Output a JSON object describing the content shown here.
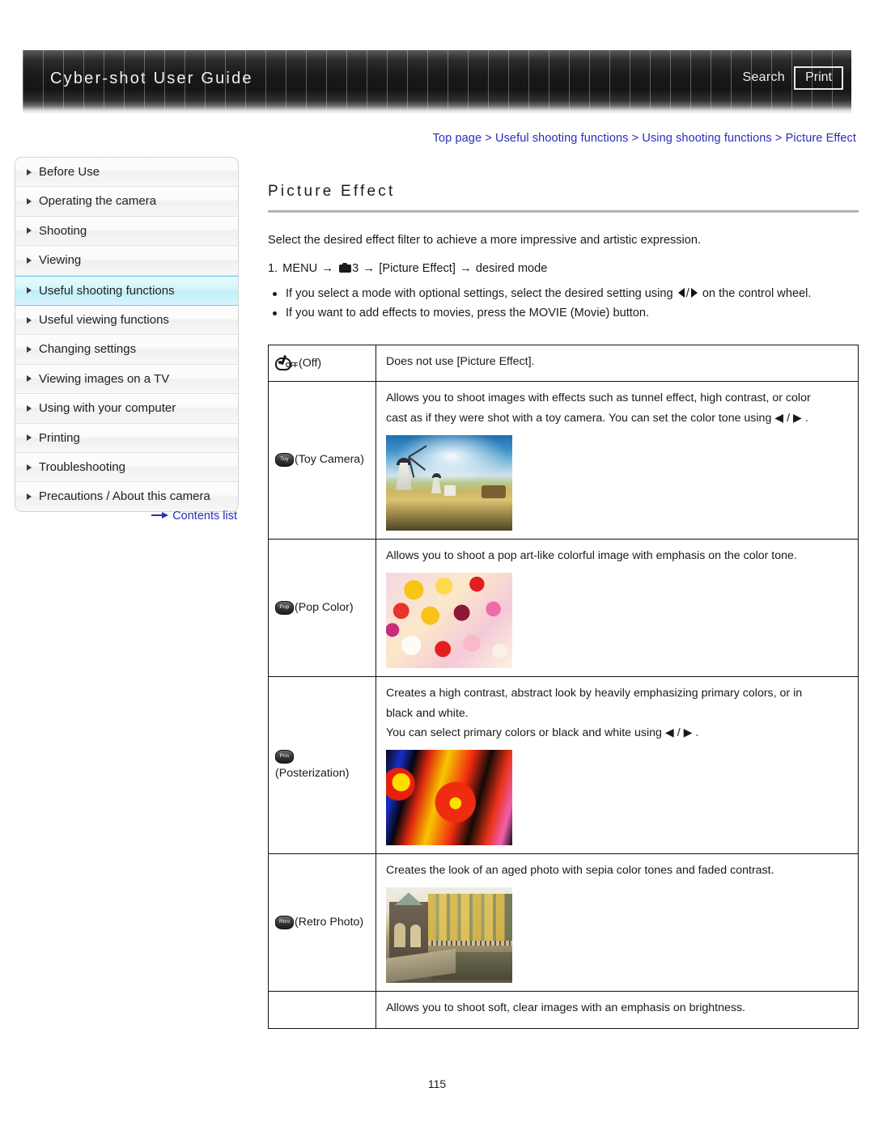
{
  "header": {
    "title": "Cyber-shot User Guide",
    "search_label": "Search",
    "print_label": "Print"
  },
  "breadcrumb": {
    "items": [
      "Top page",
      "Useful shooting functions",
      "Using shooting functions",
      "Picture Effect"
    ],
    "separator": ">",
    "full_text": "Top page > Useful shooting functions > Using shooting functions > Picture Effect"
  },
  "sidebar": {
    "items": [
      {
        "label": "Before Use",
        "active": false
      },
      {
        "label": "Operating the camera",
        "active": false
      },
      {
        "label": "Shooting",
        "active": false
      },
      {
        "label": "Viewing",
        "active": false
      },
      {
        "label": "Useful shooting functions",
        "active": true
      },
      {
        "label": "Useful viewing functions",
        "active": false
      },
      {
        "label": "Changing settings",
        "active": false
      },
      {
        "label": "Viewing images on a TV",
        "active": false
      },
      {
        "label": "Using with your computer",
        "active": false
      },
      {
        "label": "Printing",
        "active": false
      },
      {
        "label": "Troubleshooting",
        "active": false
      },
      {
        "label": "Precautions / About this camera",
        "active": false
      }
    ],
    "contents_link": "Contents list",
    "active_color": "#bfeefa",
    "link_color": "#2b2bbd"
  },
  "main": {
    "title": "Picture Effect",
    "intro": "Select the desired effect filter to achieve a more impressive and artistic expression.",
    "step": {
      "number": "1.",
      "menu": "MENU",
      "tab": "3",
      "item": "[Picture Effect]",
      "result": "desired mode"
    },
    "bullets": [
      "If you select a mode with optional settings, select the desired setting using  ◀ / ▶  on the control wheel.",
      "If you want to add effects to movies, press the MOVIE (Movie) button."
    ],
    "bullet1_a": "If you select a mode with optional settings, select the desired setting using",
    "bullet1_b": "on the control wheel.",
    "bullet2": "If you want to add effects to movies, press the MOVIE (Movie) button."
  },
  "table": {
    "rows": [
      {
        "icon": "paint-off-icon",
        "icon_text": "OFF",
        "label": "(Off)",
        "desc1": "Does not use [Picture Effect].",
        "desc2": "",
        "desc3": "",
        "has_image": false,
        "image_alt": ""
      },
      {
        "icon": "toy-camera-icon",
        "icon_text": "Toy",
        "label": "(Toy Camera)",
        "desc1": "Allows you to shoot images with effects such as tunnel effect, high contrast, or color",
        "desc2": "cast as if they were shot with a toy camera. You can set the color tone using  ◀ / ▶ .",
        "desc3": "",
        "has_image": true,
        "image_alt": "windmill landscape sample"
      },
      {
        "icon": "pop-color-icon",
        "icon_text": "Pop",
        "label": "(Pop Color)",
        "desc1": "Allows you to shoot a pop art-like colorful image with emphasis on the color tone.",
        "desc2": "",
        "desc3": "",
        "has_image": true,
        "image_alt": "colorful flowers sample"
      },
      {
        "icon": "posterization-icon",
        "icon_text": "Pos",
        "label": "(Posterization)",
        "desc1": "Creates a high contrast, abstract look by heavily emphasizing primary colors, or in",
        "desc2": "black and white.",
        "desc3": "You can select primary colors or black and white using  ◀ / ▶ .",
        "has_image": true,
        "image_alt": "high contrast flower sample"
      },
      {
        "icon": "retro-photo-icon",
        "icon_text": "Rtro",
        "label": "(Retro Photo)",
        "desc1": "Creates the look of an aged photo with sepia color tones and faded contrast.",
        "desc2": "",
        "desc3": "",
        "has_image": true,
        "image_alt": "sepia building with autumn trees sample"
      },
      {
        "icon": "",
        "icon_text": "",
        "label": "",
        "desc1": "Allows you to shoot soft, clear images with an emphasis on brightness.",
        "desc2": "",
        "desc3": "",
        "has_image": false,
        "image_alt": ""
      }
    ]
  },
  "footer": {
    "page_number": "115"
  }
}
